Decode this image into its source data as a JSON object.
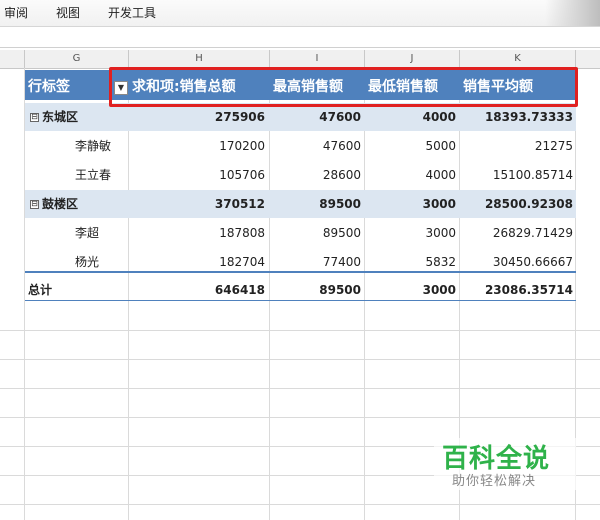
{
  "menu": {
    "items": [
      "审阅",
      "视图",
      "开发工具"
    ]
  },
  "columns": [
    "G",
    "H",
    "I",
    "J",
    "K"
  ],
  "pivot": {
    "headers": {
      "row_label": "行标签",
      "sum": "求和项:销售总额",
      "max": "最高销售额",
      "min": "最低销售额",
      "avg": "销售平均额"
    },
    "groups": [
      {
        "name": "东城区",
        "toggle": "⊟",
        "values": [
          "275906",
          "47600",
          "4000",
          "18393.73333"
        ],
        "rows": [
          {
            "name": "李静敏",
            "values": [
              "170200",
              "47600",
              "5000",
              "21275"
            ]
          },
          {
            "name": "王立春",
            "values": [
              "105706",
              "28600",
              "4000",
              "15100.85714"
            ]
          }
        ]
      },
      {
        "name": "鼓楼区",
        "toggle": "⊟",
        "values": [
          "370512",
          "89500",
          "3000",
          "28500.92308"
        ],
        "rows": [
          {
            "name": "李超",
            "values": [
              "187808",
              "89500",
              "3000",
              "26829.71429"
            ]
          },
          {
            "name": "杨光",
            "values": [
              "182704",
              "77400",
              "5832",
              "30450.66667"
            ]
          }
        ]
      }
    ],
    "total": {
      "label": "总计",
      "values": [
        "646418",
        "89500",
        "3000",
        "23086.35714"
      ]
    }
  },
  "watermark": {
    "title": "百科全说",
    "subtitle": "助你轻松解决"
  },
  "colors": {
    "header_bg": "#4f81bd",
    "band_bg": "#dce6f1",
    "highlight": "#e02020",
    "watermark": "#2fb24a"
  }
}
